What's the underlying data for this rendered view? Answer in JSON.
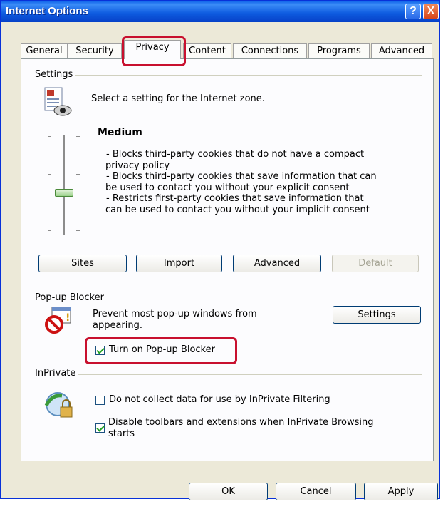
{
  "window": {
    "title": "Internet Options"
  },
  "titlebar": {
    "help_label": "?",
    "close_label": "X"
  },
  "tabs": [
    {
      "label": "General"
    },
    {
      "label": "Security"
    },
    {
      "label": "Privacy"
    },
    {
      "label": "Content"
    },
    {
      "label": "Connections"
    },
    {
      "label": "Programs"
    },
    {
      "label": "Advanced"
    }
  ],
  "settings": {
    "group_label": "Settings",
    "zone_text": "Select a setting for the Internet zone.",
    "level_title": "Medium",
    "description_lines": [
      "- Blocks third-party cookies that do not have a compact",
      "privacy policy",
      "- Blocks third-party cookies that save information that can",
      "be used to contact you without your explicit consent",
      "- Restricts first-party cookies that save information that",
      "can be used to contact you without your implicit consent"
    ],
    "slider_level": "Medium",
    "buttons": {
      "sites": "Sites",
      "import": "Import",
      "advanced": "Advanced",
      "default": "Default"
    }
  },
  "popup_blocker": {
    "group_label": "Pop-up Blocker",
    "description_lines": [
      "Prevent most pop-up windows from",
      "appearing."
    ],
    "settings_button": "Settings",
    "checkbox_label": "Turn on Pop-up Blocker",
    "checkbox_checked": true
  },
  "inprivate": {
    "group_label": "InPrivate",
    "filtering_label": "Do not collect data for use by InPrivate Filtering",
    "filtering_checked": false,
    "toolbars_label_lines": [
      "Disable toolbars and extensions when InPrivate Browsing",
      "starts"
    ],
    "toolbars_checked": true
  },
  "footer": {
    "ok": "OK",
    "cancel": "Cancel",
    "apply": "Apply"
  },
  "colors": {
    "highlight": "#c8102e",
    "titlebar": "#0a5ee8",
    "dialog": "#ece9d8"
  }
}
